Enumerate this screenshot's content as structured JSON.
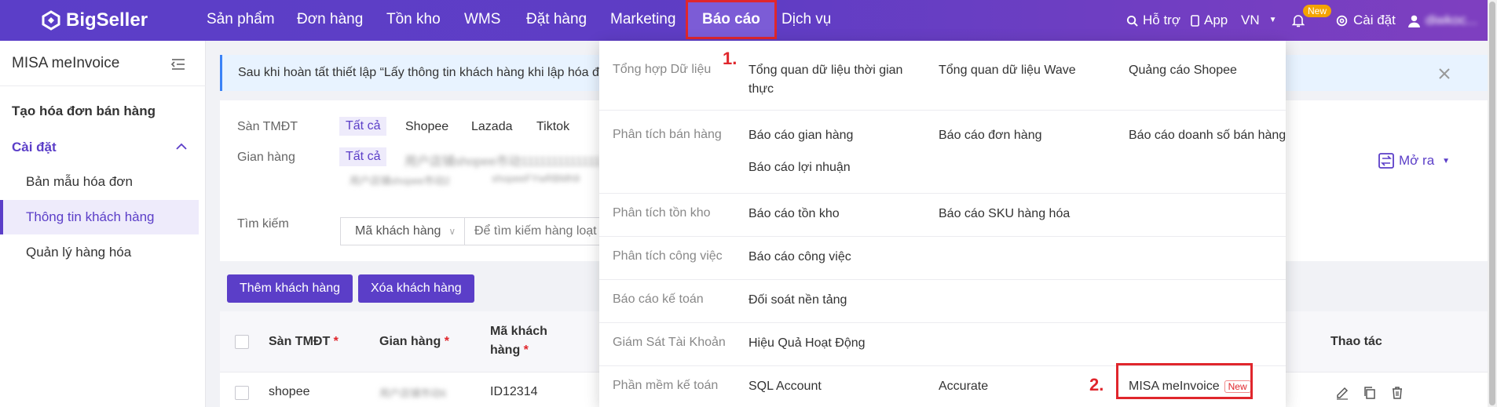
{
  "brand": {
    "name": "BigSeller"
  },
  "nav": {
    "items": [
      "Sản phẩm",
      "Đơn hàng",
      "Tồn kho",
      "WMS",
      "Đặt hàng",
      "Marketing",
      "Báo cáo",
      "Dịch vụ"
    ],
    "active": "Báo cáo"
  },
  "header_right": {
    "support": "Hỗ trợ",
    "app": "App",
    "language": "VN",
    "new_badge": "New",
    "settings": "Cài đặt",
    "username": "diwkoc..."
  },
  "annotations": {
    "step1": "1.",
    "step2": "2."
  },
  "sidebar": {
    "title": "MISA meInvoice",
    "items": [
      {
        "label": "Tạo hóa đơn bán hàng"
      },
      {
        "label": "Cài đặt"
      },
      {
        "label": "Bản mẫu hóa đơn"
      },
      {
        "label": "Thông tin khách hàng"
      },
      {
        "label": "Quản lý hàng hóa"
      }
    ]
  },
  "notice": {
    "text": "Sau khi hoàn tất thiết lập “Lấy thông tin khách hàng khi lập hóa đơ"
  },
  "filters": {
    "platform_label": "Sàn TMĐT",
    "platform_options": [
      "Tất cả",
      "Shopee",
      "Lazada",
      "Tiktok"
    ],
    "store_label": "Gian hàng",
    "store_all": "Tất cả",
    "store_blur_1": "用户店铺shopee市动1111111111111",
    "store_blur_2": "用户店铺shopee市动2",
    "store_blur_3": "shopeeFYwRBMh9",
    "search_label": "Tìm kiếm",
    "search_field": "Mã khách hàng",
    "search_placeholder": "Để tìm kiếm hàng loạt c",
    "expand": "Mở ra"
  },
  "actions": {
    "add": "Thêm khách hàng",
    "delete": "Xóa khách hàng"
  },
  "table": {
    "headers": [
      "Sàn TMĐT",
      "Gian hàng",
      "Mã khách",
      "hàng",
      "Thao tác"
    ],
    "required_mark": "*",
    "rows": [
      {
        "platform": "shopee",
        "store": "用户店铺市动6",
        "code": "ID12314"
      }
    ]
  },
  "report_menu": {
    "rows": [
      {
        "category": "Tổng hợp Dữ liệu",
        "links": [
          "Tổng quan dữ liệu thời gian",
          "thực",
          "Tổng quan dữ liệu Wave",
          "Quảng cáo Shopee"
        ]
      },
      {
        "category": "Phân tích bán hàng",
        "links": [
          "Báo cáo gian hàng",
          "Báo cáo đơn hàng",
          "Báo cáo doanh số bán hàng",
          "Báo cáo lợi nhuận"
        ]
      },
      {
        "category": "Phân tích tồn kho",
        "links": [
          "Báo cáo tồn kho",
          "Báo cáo SKU hàng hóa"
        ]
      },
      {
        "category": "Phân tích công việc",
        "links": [
          "Báo cáo công việc"
        ]
      },
      {
        "category": "Báo cáo kế toán",
        "links": [
          "Đối soát nền tảng"
        ]
      },
      {
        "category": "Giám Sát Tài Khoản",
        "links": [
          "Hiệu Quả Hoạt Động"
        ]
      },
      {
        "category": "Phần mềm kế toán",
        "links": [
          "SQL Account",
          "Accurate",
          "MISA meInvoice"
        ],
        "new_badge": "New"
      }
    ]
  },
  "colors": {
    "brand": "#5b3ec8",
    "highlight": "#e0262c"
  }
}
